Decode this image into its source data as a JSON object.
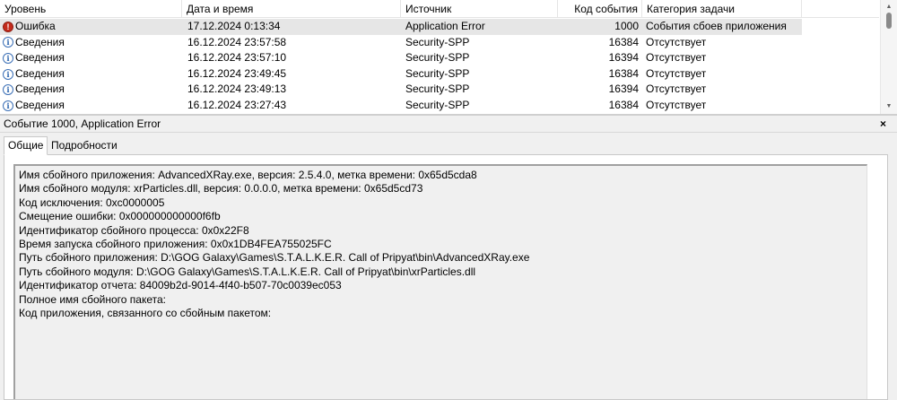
{
  "columns": {
    "level": "Уровень",
    "date": "Дата и время",
    "source": "Источник",
    "code": "Код события",
    "category": "Категория задачи"
  },
  "events": [
    {
      "level": "Ошибка",
      "level_icon": "error-icon",
      "date": "17.12.2024 0:13:34",
      "source": "Application Error",
      "code": "1000",
      "category": "События сбоев приложения",
      "selected": true
    },
    {
      "level": "Сведения",
      "level_icon": "info-icon",
      "date": "16.12.2024 23:57:58",
      "source": "Security-SPP",
      "code": "16384",
      "category": "Отсутствует"
    },
    {
      "level": "Сведения",
      "level_icon": "info-icon",
      "date": "16.12.2024 23:57:10",
      "source": "Security-SPP",
      "code": "16394",
      "category": "Отсутствует"
    },
    {
      "level": "Сведения",
      "level_icon": "info-icon",
      "date": "16.12.2024 23:49:45",
      "source": "Security-SPP",
      "code": "16384",
      "category": "Отсутствует"
    },
    {
      "level": "Сведения",
      "level_icon": "info-icon",
      "date": "16.12.2024 23:49:13",
      "source": "Security-SPP",
      "code": "16394",
      "category": "Отсутствует"
    },
    {
      "level": "Сведения",
      "level_icon": "info-icon",
      "date": "16.12.2024 23:27:43",
      "source": "Security-SPP",
      "code": "16384",
      "category": "Отсутствует"
    }
  ],
  "details": {
    "title": "Событие 1000, Application Error",
    "close_symbol": "×",
    "tabs": [
      "Общие",
      "Подробности"
    ],
    "active_tab": "Общие",
    "lines": [
      "Имя сбойного приложения: AdvancedXRay.exe, версия: 2.5.4.0, метка времени: 0x65d5cda8",
      "Имя сбойного модуля: xrParticles.dll, версия: 0.0.0.0, метка времени: 0x65d5cd73",
      "Код исключения: 0xc0000005",
      "Смещение ошибки: 0x000000000000f6fb",
      "Идентификатор сбойного процесса: 0x0x22F8",
      "Время запуска сбойного приложения: 0x0x1DB4FEA755025FC",
      "Путь сбойного приложения: D:\\GOG Galaxy\\Games\\S.T.A.L.K.E.R. Call of Pripyat\\bin\\AdvancedXRay.exe",
      "Путь сбойного модуля: D:\\GOG Galaxy\\Games\\S.T.A.L.K.E.R. Call of Pripyat\\bin\\xrParticles.dll",
      "Идентификатор отчета: 84009b2d-9014-4f40-b507-70c0039ec053",
      "Полное имя сбойного пакета:",
      "Код приложения, связанного со сбойным пакетом:"
    ]
  },
  "colors": {
    "selected_row": "#e6e6e6",
    "error_icon": "#c42b1c",
    "info_icon": "#1e5aa8",
    "pane_bg": "#f0f0f0"
  }
}
